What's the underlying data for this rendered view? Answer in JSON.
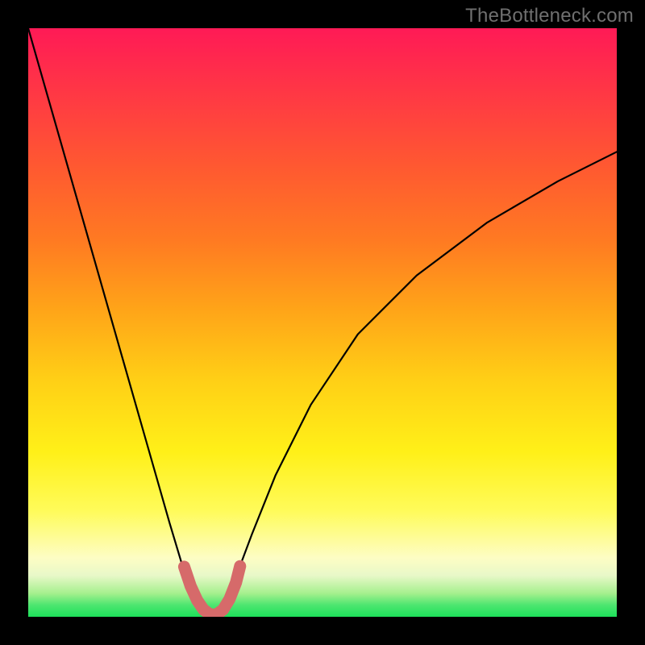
{
  "watermark": "TheBottleneck.com",
  "chart_data": {
    "type": "line",
    "title": "",
    "xlabel": "",
    "ylabel": "",
    "xlim": [
      0,
      100
    ],
    "ylim": [
      0,
      100
    ],
    "grid": false,
    "legend": false,
    "series": [
      {
        "name": "main-curve",
        "color": "#000000",
        "x": [
          0,
          4,
          8,
          12,
          16,
          20,
          24,
          27,
          29,
          30.5,
          32,
          33.5,
          35,
          38,
          42,
          48,
          56,
          66,
          78,
          90,
          100
        ],
        "y": [
          100,
          86,
          72,
          58,
          44,
          30,
          16,
          6,
          2,
          0.3,
          0.3,
          2,
          6,
          14,
          24,
          36,
          48,
          58,
          67,
          74,
          79
        ]
      },
      {
        "name": "bottom-marker",
        "color": "#d66a6a",
        "x": [
          26.5,
          27.6,
          28.7,
          29.8,
          30.9,
          32.0,
          33.1,
          34.2,
          35.3,
          36.0
        ],
        "y": [
          8.5,
          5.2,
          2.8,
          1.2,
          0.4,
          0.4,
          1.2,
          3.0,
          5.8,
          8.6
        ]
      }
    ]
  }
}
